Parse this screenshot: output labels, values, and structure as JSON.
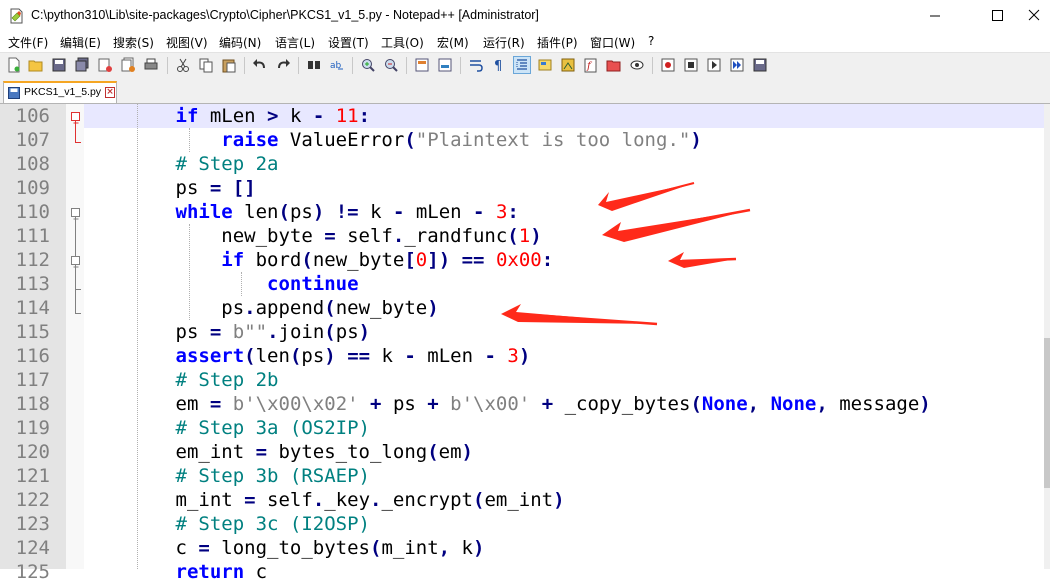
{
  "window": {
    "title": "C:\\python310\\Lib\\site-packages\\Crypto\\Cipher\\PKCS1_v1_5.py - Notepad++ [Administrator]",
    "app_icon": "notepad-plus-plus-icon"
  },
  "menu": [
    {
      "id": "file",
      "label": "文件(F)"
    },
    {
      "id": "edit",
      "label": "编辑(E)"
    },
    {
      "id": "search",
      "label": "搜索(S)"
    },
    {
      "id": "view",
      "label": "视图(V)"
    },
    {
      "id": "encoding",
      "label": "编码(N)"
    },
    {
      "id": "language",
      "label": "语言(L)"
    },
    {
      "id": "settings",
      "label": "设置(T)"
    },
    {
      "id": "tools",
      "label": "工具(O)"
    },
    {
      "id": "macro",
      "label": "宏(M)"
    },
    {
      "id": "run",
      "label": "运行(R)"
    },
    {
      "id": "plugins",
      "label": "插件(P)"
    },
    {
      "id": "window",
      "label": "窗口(W)"
    },
    {
      "id": "help",
      "label": "?"
    }
  ],
  "tabs": [
    {
      "label": "PKCS1_v1_5.py",
      "active": true,
      "icon": "save-disk-icon"
    }
  ],
  "editor": {
    "lines": [
      {
        "n": "106",
        "tokens": [
          [
            "pl",
            "        "
          ],
          [
            "kw",
            "if"
          ],
          [
            "pl",
            " mLen "
          ],
          [
            "op",
            ">"
          ],
          [
            "pl",
            " k "
          ],
          [
            "op",
            "-"
          ],
          [
            "pl",
            " "
          ],
          [
            "num",
            "11"
          ],
          [
            "op",
            ":"
          ]
        ]
      },
      {
        "n": "107",
        "tokens": [
          [
            "pl",
            "            "
          ],
          [
            "kw",
            "raise"
          ],
          [
            "pl",
            " ValueError"
          ],
          [
            "op",
            "("
          ],
          [
            "str",
            "\"Plaintext is too long.\""
          ],
          [
            "op",
            ")"
          ]
        ]
      },
      {
        "n": "108",
        "tokens": [
          [
            "pl",
            "        "
          ],
          [
            "com",
            "# Step 2a"
          ]
        ]
      },
      {
        "n": "109",
        "tokens": [
          [
            "pl",
            "        ps "
          ],
          [
            "op",
            "="
          ],
          [
            "pl",
            " "
          ],
          [
            "op",
            "[]"
          ]
        ]
      },
      {
        "n": "110",
        "tokens": [
          [
            "pl",
            "        "
          ],
          [
            "kw",
            "while"
          ],
          [
            "pl",
            " len"
          ],
          [
            "op",
            "("
          ],
          [
            "pl",
            "ps"
          ],
          [
            "op",
            ")"
          ],
          [
            "pl",
            " "
          ],
          [
            "op",
            "!="
          ],
          [
            "pl",
            " k "
          ],
          [
            "op",
            "-"
          ],
          [
            "pl",
            " mLen "
          ],
          [
            "op",
            "-"
          ],
          [
            "pl",
            " "
          ],
          [
            "num",
            "3"
          ],
          [
            "op",
            ":"
          ]
        ]
      },
      {
        "n": "111",
        "tokens": [
          [
            "pl",
            "            new_byte "
          ],
          [
            "op",
            "="
          ],
          [
            "pl",
            " self"
          ],
          [
            "op",
            "."
          ],
          [
            "pl",
            "_randfunc"
          ],
          [
            "op",
            "("
          ],
          [
            "num",
            "1"
          ],
          [
            "op",
            ")"
          ]
        ]
      },
      {
        "n": "112",
        "tokens": [
          [
            "pl",
            "            "
          ],
          [
            "kw",
            "if"
          ],
          [
            "pl",
            " bord"
          ],
          [
            "op",
            "("
          ],
          [
            "pl",
            "new_byte"
          ],
          [
            "op",
            "["
          ],
          [
            "num",
            "0"
          ],
          [
            "op",
            "])"
          ],
          [
            "pl",
            " "
          ],
          [
            "op",
            "=="
          ],
          [
            "pl",
            " "
          ],
          [
            "num",
            "0x00"
          ],
          [
            "op",
            ":"
          ]
        ]
      },
      {
        "n": "113",
        "tokens": [
          [
            "pl",
            "                "
          ],
          [
            "kw",
            "continue"
          ]
        ]
      },
      {
        "n": "114",
        "tokens": [
          [
            "pl",
            "            ps"
          ],
          [
            "op",
            "."
          ],
          [
            "pl",
            "append"
          ],
          [
            "op",
            "("
          ],
          [
            "pl",
            "new_byte"
          ],
          [
            "op",
            ")"
          ]
        ]
      },
      {
        "n": "115",
        "tokens": [
          [
            "pl",
            "        ps "
          ],
          [
            "op",
            "="
          ],
          [
            "pl",
            " "
          ],
          [
            "str",
            "b\"\""
          ],
          [
            "op",
            "."
          ],
          [
            "pl",
            "join"
          ],
          [
            "op",
            "("
          ],
          [
            "pl",
            "ps"
          ],
          [
            "op",
            ")"
          ]
        ]
      },
      {
        "n": "116",
        "tokens": [
          [
            "pl",
            "        "
          ],
          [
            "kw",
            "assert"
          ],
          [
            "op",
            "("
          ],
          [
            "pl",
            "len"
          ],
          [
            "op",
            "("
          ],
          [
            "pl",
            "ps"
          ],
          [
            "op",
            ")"
          ],
          [
            "pl",
            " "
          ],
          [
            "op",
            "=="
          ],
          [
            "pl",
            " k "
          ],
          [
            "op",
            "-"
          ],
          [
            "pl",
            " mLen "
          ],
          [
            "op",
            "-"
          ],
          [
            "pl",
            " "
          ],
          [
            "num",
            "3"
          ],
          [
            "op",
            ")"
          ]
        ]
      },
      {
        "n": "117",
        "tokens": [
          [
            "pl",
            "        "
          ],
          [
            "com",
            "# Step 2b"
          ]
        ]
      },
      {
        "n": "118",
        "tokens": [
          [
            "pl",
            "        em "
          ],
          [
            "op",
            "="
          ],
          [
            "pl",
            " "
          ],
          [
            "str",
            "b'\\x00\\x02'"
          ],
          [
            "pl",
            " "
          ],
          [
            "op",
            "+"
          ],
          [
            "pl",
            " ps "
          ],
          [
            "op",
            "+"
          ],
          [
            "pl",
            " "
          ],
          [
            "str",
            "b'\\x00'"
          ],
          [
            "pl",
            " "
          ],
          [
            "op",
            "+"
          ],
          [
            "pl",
            " _copy_bytes"
          ],
          [
            "op",
            "("
          ],
          [
            "kw",
            "None"
          ],
          [
            "op",
            ","
          ],
          [
            "pl",
            " "
          ],
          [
            "kw",
            "None"
          ],
          [
            "op",
            ","
          ],
          [
            "pl",
            " message"
          ],
          [
            "op",
            ")"
          ]
        ]
      },
      {
        "n": "119",
        "tokens": [
          [
            "pl",
            "        "
          ],
          [
            "com",
            "# Step 3a (OS2IP)"
          ]
        ]
      },
      {
        "n": "120",
        "tokens": [
          [
            "pl",
            "        em_int "
          ],
          [
            "op",
            "="
          ],
          [
            "pl",
            " bytes_to_long"
          ],
          [
            "op",
            "("
          ],
          [
            "pl",
            "em"
          ],
          [
            "op",
            ")"
          ]
        ]
      },
      {
        "n": "121",
        "tokens": [
          [
            "pl",
            "        "
          ],
          [
            "com",
            "# Step 3b (RSAEP)"
          ]
        ]
      },
      {
        "n": "122",
        "tokens": [
          [
            "pl",
            "        m_int "
          ],
          [
            "op",
            "="
          ],
          [
            "pl",
            " self"
          ],
          [
            "op",
            "."
          ],
          [
            "pl",
            "_key"
          ],
          [
            "op",
            "."
          ],
          [
            "pl",
            "_encrypt"
          ],
          [
            "op",
            "("
          ],
          [
            "pl",
            "em_int"
          ],
          [
            "op",
            ")"
          ]
        ]
      },
      {
        "n": "123",
        "tokens": [
          [
            "pl",
            "        "
          ],
          [
            "com",
            "# Step 3c (I2OSP)"
          ]
        ]
      },
      {
        "n": "124",
        "tokens": [
          [
            "pl",
            "        c "
          ],
          [
            "op",
            "="
          ],
          [
            "pl",
            " long_to_bytes"
          ],
          [
            "op",
            "("
          ],
          [
            "pl",
            "m_int"
          ],
          [
            "op",
            ","
          ],
          [
            "pl",
            " k"
          ],
          [
            "op",
            ")"
          ]
        ]
      },
      {
        "n": "125",
        "tokens": [
          [
            "pl",
            "        "
          ],
          [
            "kw",
            "return"
          ],
          [
            "pl",
            " c"
          ]
        ]
      }
    ]
  },
  "colors": {
    "annotation_arrow": "#ff2a1a",
    "keyword": "#0000ff",
    "number": "#ff0000",
    "comment": "#008080",
    "string": "#808080",
    "operator": "#000080"
  }
}
